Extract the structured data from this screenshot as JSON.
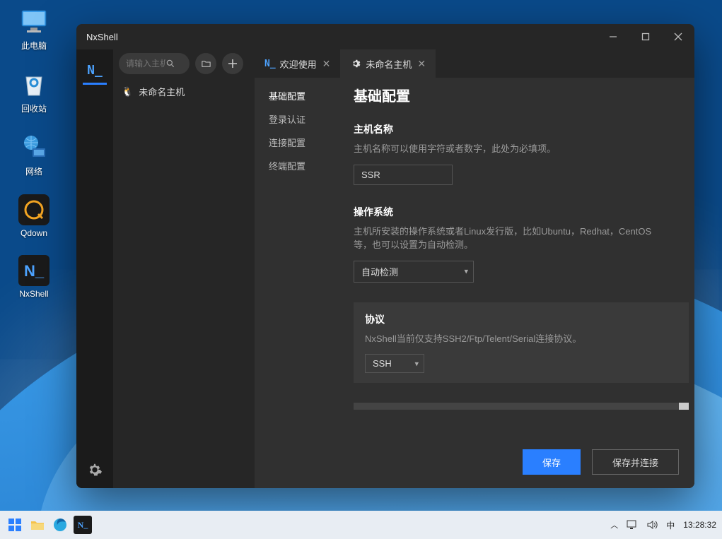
{
  "desktop": {
    "icons": [
      {
        "label": "此电脑",
        "name": "this-pc"
      },
      {
        "label": "回收站",
        "name": "recycle-bin"
      },
      {
        "label": "网络",
        "name": "network"
      },
      {
        "label": "Qdown",
        "name": "qdown"
      },
      {
        "label": "NxShell",
        "name": "nxshell-app"
      }
    ]
  },
  "window": {
    "title": "NxShell"
  },
  "rail": {
    "logo": "N_"
  },
  "toolbar": {
    "search_placeholder": "请输入主机",
    "tabs": [
      {
        "icon": "N_",
        "label": "欢迎使用",
        "active": false
      },
      {
        "icon": "gear",
        "label": "未命名主机",
        "active": true
      }
    ]
  },
  "sidebar": {
    "host_label": "未命名主机"
  },
  "menu": {
    "items": [
      {
        "label": "基础配置",
        "active": true
      },
      {
        "label": "登录认证",
        "active": false
      },
      {
        "label": "连接配置",
        "active": false
      },
      {
        "label": "终端配置",
        "active": false
      }
    ]
  },
  "form": {
    "section_title": "基础配置",
    "hostname": {
      "label": "主机名称",
      "desc": "主机名称可以使用字符或者数字，此处为必填项。",
      "value": "SSR"
    },
    "os": {
      "label": "操作系统",
      "desc": "主机所安装的操作系统或者Linux发行版，比如Ubuntu，Redhat，CentOS等，也可以设置为自动检测。",
      "value": "自动检测"
    },
    "protocol": {
      "label": "协议",
      "desc": "NxShell当前仅支持SSH2/Ftp/Telent/Serial连接协议。",
      "value": "SSH"
    }
  },
  "footer": {
    "save": "保存",
    "save_connect": "保存并连接"
  },
  "taskbar": {
    "ime": "中",
    "time": "13:28:32"
  }
}
